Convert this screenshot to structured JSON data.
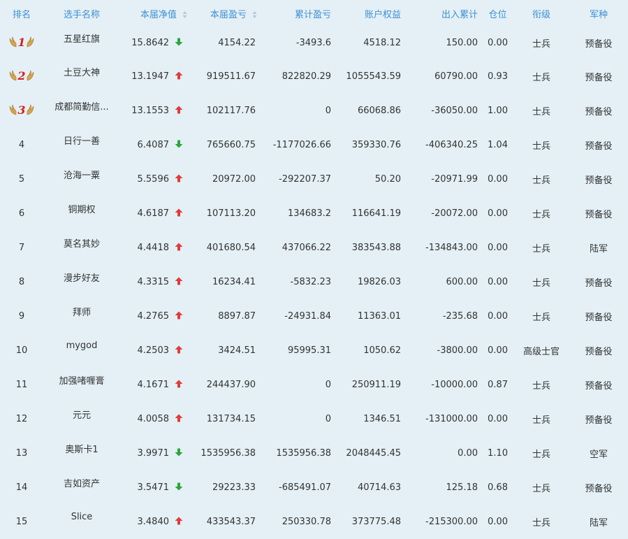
{
  "headers": {
    "rank": "排名",
    "player": "选手名称",
    "net_value": "本届净值",
    "profit": "本届盈亏",
    "cum_profit": "累计盈亏",
    "equity": "账户权益",
    "inout": "出入累计",
    "position": "仓位",
    "title": "衔级",
    "branch": "军种"
  },
  "colors": {
    "header_text": "#3f8fd2",
    "up": "#e23a3a",
    "down": "#2aa63a",
    "medal": "#d21f1f"
  },
  "rows": [
    {
      "rank": "1",
      "medal": true,
      "name": "五星红旗",
      "net": "15.8642",
      "dir": "down",
      "profit": "4154.22",
      "cum": "-3493.6",
      "equity": "4518.12",
      "inout": "150.00",
      "pos": "0.00",
      "title": "士兵",
      "branch": "预备役"
    },
    {
      "rank": "2",
      "medal": true,
      "name": "土豆大神",
      "net": "13.1947",
      "dir": "up",
      "profit": "919511.67",
      "cum": "822820.29",
      "equity": "1055543.59",
      "inout": "60790.00",
      "pos": "0.93",
      "title": "士兵",
      "branch": "预备役"
    },
    {
      "rank": "3",
      "medal": true,
      "name": "成都简勤信...",
      "net": "13.1553",
      "dir": "up",
      "profit": "102117.76",
      "cum": "0",
      "equity": "66068.86",
      "inout": "-36050.00",
      "pos": "1.00",
      "title": "士兵",
      "branch": "预备役"
    },
    {
      "rank": "4",
      "medal": false,
      "name": "日行一善",
      "net": "6.4087",
      "dir": "down",
      "profit": "765660.75",
      "cum": "-1177026.66",
      "equity": "359330.76",
      "inout": "-406340.25",
      "pos": "1.04",
      "title": "士兵",
      "branch": "预备役"
    },
    {
      "rank": "5",
      "medal": false,
      "name": "沧海一粟",
      "net": "5.5596",
      "dir": "up",
      "profit": "20972.00",
      "cum": "-292207.37",
      "equity": "50.20",
      "inout": "-20971.99",
      "pos": "0.00",
      "title": "士兵",
      "branch": "预备役"
    },
    {
      "rank": "6",
      "medal": false,
      "name": "铜期权",
      "net": "4.6187",
      "dir": "up",
      "profit": "107113.20",
      "cum": "134683.2",
      "equity": "116641.19",
      "inout": "-20072.00",
      "pos": "0.00",
      "title": "士兵",
      "branch": "预备役"
    },
    {
      "rank": "7",
      "medal": false,
      "name": "莫名其妙",
      "net": "4.4418",
      "dir": "up",
      "profit": "401680.54",
      "cum": "437066.22",
      "equity": "383543.88",
      "inout": "-134843.00",
      "pos": "0.00",
      "title": "士兵",
      "branch": "陆军"
    },
    {
      "rank": "8",
      "medal": false,
      "name": "漫步好友",
      "net": "4.3315",
      "dir": "up",
      "profit": "16234.41",
      "cum": "-5832.23",
      "equity": "19826.03",
      "inout": "600.00",
      "pos": "0.00",
      "title": "士兵",
      "branch": "预备役"
    },
    {
      "rank": "9",
      "medal": false,
      "name": "拜师",
      "net": "4.2765",
      "dir": "up",
      "profit": "8897.87",
      "cum": "-24931.84",
      "equity": "11363.01",
      "inout": "-235.68",
      "pos": "0.00",
      "title": "士兵",
      "branch": "预备役"
    },
    {
      "rank": "10",
      "medal": false,
      "name": "mygod",
      "net": "4.2503",
      "dir": "up",
      "profit": "3424.51",
      "cum": "95995.31",
      "equity": "1050.62",
      "inout": "-3800.00",
      "pos": "0.00",
      "title": "高级士官",
      "branch": "预备役"
    },
    {
      "rank": "11",
      "medal": false,
      "name": "加强啫喱膏",
      "net": "4.1671",
      "dir": "up",
      "profit": "244437.90",
      "cum": "0",
      "equity": "250911.19",
      "inout": "-10000.00",
      "pos": "0.87",
      "title": "士兵",
      "branch": "预备役"
    },
    {
      "rank": "12",
      "medal": false,
      "name": "元元",
      "net": "4.0058",
      "dir": "up",
      "profit": "131734.15",
      "cum": "0",
      "equity": "1346.51",
      "inout": "-131000.00",
      "pos": "0.00",
      "title": "士兵",
      "branch": "预备役"
    },
    {
      "rank": "13",
      "medal": false,
      "name": "奥斯卡1",
      "net": "3.9971",
      "dir": "down",
      "profit": "1535956.38",
      "cum": "1535956.38",
      "equity": "2048445.45",
      "inout": "0.00",
      "pos": "1.10",
      "title": "士兵",
      "branch": "空军"
    },
    {
      "rank": "14",
      "medal": false,
      "name": "吉如资产",
      "net": "3.5471",
      "dir": "down",
      "profit": "29223.33",
      "cum": "-685491.07",
      "equity": "40714.63",
      "inout": "125.18",
      "pos": "0.68",
      "title": "士兵",
      "branch": "预备役"
    },
    {
      "rank": "15",
      "medal": false,
      "name": "Slice",
      "net": "3.4840",
      "dir": "up",
      "profit": "433543.37",
      "cum": "250330.78",
      "equity": "373775.48",
      "inout": "-215300.00",
      "pos": "0.00",
      "title": "士兵",
      "branch": "陆军"
    }
  ]
}
